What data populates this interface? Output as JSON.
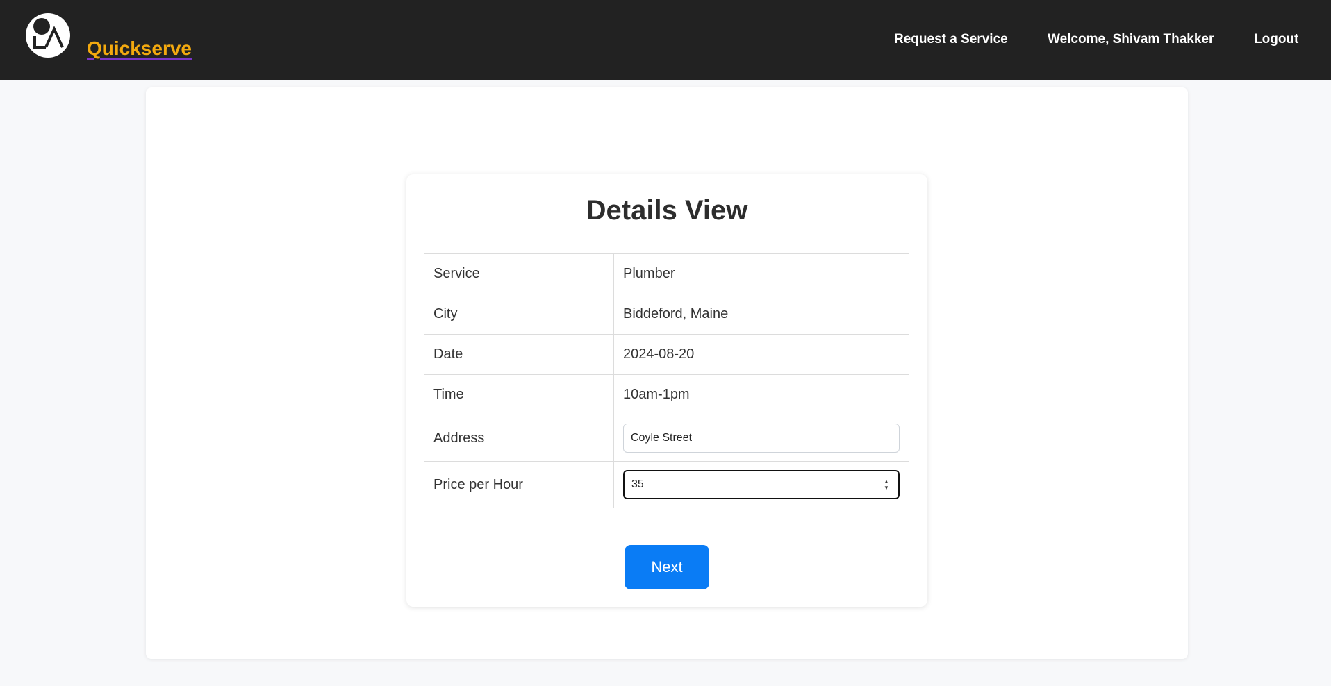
{
  "header": {
    "brand": "Quickserve",
    "logo_icon": "circle-figure-logo-icon",
    "nav": {
      "request_service": "Request a Service",
      "welcome": "Welcome, Shivam Thakker",
      "logout": "Logout"
    }
  },
  "main": {
    "title": "Details View",
    "rows": [
      {
        "label": "Service",
        "value": "Plumber"
      },
      {
        "label": "City",
        "value": "Biddeford, Maine"
      },
      {
        "label": "Date",
        "value": "2024-08-20"
      },
      {
        "label": "Time",
        "value": "10am-1pm"
      }
    ],
    "address": {
      "label": "Address",
      "value": "Coyle Street"
    },
    "price": {
      "label": "Price per Hour",
      "value": "35"
    },
    "next_button": "Next"
  },
  "colors": {
    "navbar": "#222222",
    "brand": "#f3a90f",
    "brand_underline": "#7a35c9",
    "primary_button": "#0a7cf5",
    "page_background": "#f7f8fa"
  }
}
